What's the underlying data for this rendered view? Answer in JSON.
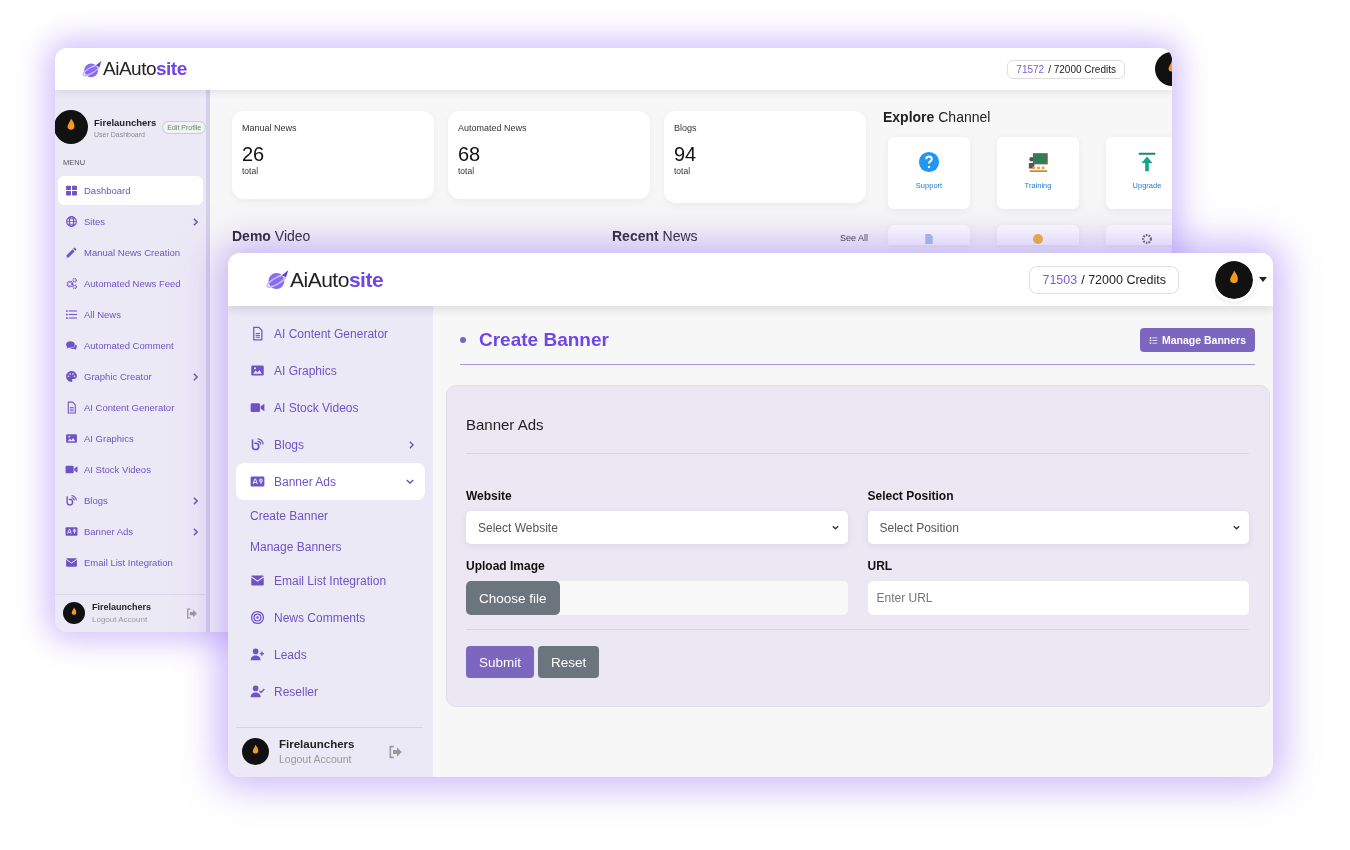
{
  "back_window": {
    "logo": "AiAuto**site**",
    "credits": {
      "used": "71572",
      "total": "/ 72000 Credits"
    },
    "profile": {
      "name": "Firelaunchers",
      "role": "User Dashboard",
      "edit_button": "Edit Profile"
    },
    "menu_heading": "MENU",
    "sidebar": {
      "items": [
        {
          "label": "Dashboard",
          "kind": "grid",
          "selected": true,
          "expandable": false,
          "expanded": false
        },
        {
          "label": "Sites",
          "kind": "globe",
          "selected": false,
          "expandable": true,
          "expanded": false
        },
        {
          "label": "Manual News Creation",
          "kind": "pencil",
          "selected": false,
          "expandable": false,
          "expanded": false
        },
        {
          "label": "Automated News Feed",
          "kind": "gears",
          "selected": false,
          "expandable": false,
          "expanded": false
        },
        {
          "label": "All News",
          "kind": "list",
          "selected": false,
          "expandable": false,
          "expanded": false
        },
        {
          "label": "Automated Comment",
          "kind": "chat",
          "selected": false,
          "expandable": false,
          "expanded": false
        },
        {
          "label": "Graphic Creator",
          "kind": "palette",
          "selected": false,
          "expandable": true,
          "expanded": false
        },
        {
          "label": "AI Content Generator",
          "kind": "document",
          "selected": false,
          "expandable": false,
          "expanded": false
        },
        {
          "label": "AI Graphics",
          "kind": "image",
          "selected": false,
          "expandable": false,
          "expanded": false
        },
        {
          "label": "AI Stock Videos",
          "kind": "video",
          "selected": false,
          "expandable": false,
          "expanded": false
        },
        {
          "label": "Blogs",
          "kind": "blog",
          "selected": false,
          "expandable": true,
          "expanded": false
        },
        {
          "label": "Banner Ads",
          "kind": "ad",
          "selected": false,
          "expandable": true,
          "expanded": false
        },
        {
          "label": "Email List Integration",
          "kind": "mail",
          "selected": false,
          "expandable": false,
          "expanded": false
        }
      ]
    },
    "footer": {
      "name": "Firelaunchers",
      "action": "Logout Account"
    },
    "stats": [
      {
        "label": "Manual News",
        "value": "26",
        "unit": "total"
      },
      {
        "label": "Automated News",
        "value": "68",
        "unit": "total"
      },
      {
        "label": "Blogs",
        "value": "94",
        "unit": "total"
      }
    ],
    "demo_heading": "**Demo** Video",
    "recent_heading": "**Recent** News",
    "see_all": "See All",
    "explore": {
      "heading": "**Explore** Channel",
      "tiles": [
        {
          "kind": "support",
          "label": "Support"
        },
        {
          "kind": "training",
          "label": "Training"
        },
        {
          "kind": "upgrade",
          "label": "Upgrade"
        },
        {
          "kind": "document"
        },
        {
          "kind": "bulb"
        },
        {
          "kind": "gear"
        }
      ]
    }
  },
  "front_window": {
    "logo": "AiAuto**site**",
    "credits": {
      "used": "71503",
      "total": "/ 72000 Credits"
    },
    "sidebar": {
      "items": [
        {
          "label": "AI Content Generator",
          "kind": "document",
          "selected": false,
          "expandable": false,
          "expanded": false
        },
        {
          "label": "AI Graphics",
          "kind": "image",
          "selected": false,
          "expandable": false,
          "expanded": false
        },
        {
          "label": "AI Stock Videos",
          "kind": "video",
          "selected": false,
          "expandable": false,
          "expanded": false
        },
        {
          "label": "Blogs",
          "kind": "blog",
          "selected": false,
          "expandable": true,
          "expanded": false
        },
        {
          "label": "Banner Ads",
          "kind": "ad",
          "selected": true,
          "expandable": true,
          "expanded": true,
          "children": [
            {
              "label": "Create Banner"
            },
            {
              "label": "Manage Banners"
            }
          ]
        },
        {
          "label": "Email List Integration",
          "kind": "mail",
          "selected": false,
          "expandable": false,
          "expanded": false
        },
        {
          "label": "News Comments",
          "kind": "target",
          "selected": false,
          "expandable": false,
          "expanded": false
        },
        {
          "label": "Leads",
          "kind": "user-plus",
          "selected": false,
          "expandable": false,
          "expanded": false
        },
        {
          "label": "Reseller",
          "kind": "user-check",
          "selected": false,
          "expandable": false,
          "expanded": false
        }
      ]
    },
    "footer": {
      "name": "Firelaunchers",
      "action": "Logout Account"
    },
    "page_title": "Create Banner",
    "manage_button": "Manage Banners",
    "form": {
      "title": "Banner Ads",
      "fields": [
        {
          "label": "Website",
          "kind": "select",
          "placeholder": "Select Website"
        },
        {
          "label": "Select Position",
          "kind": "select",
          "placeholder": "Select Position"
        },
        {
          "label": "Upload Image",
          "kind": "file",
          "button": "Choose file"
        },
        {
          "label": "URL",
          "kind": "text",
          "placeholder": "Enter URL"
        }
      ],
      "actions": [
        {
          "label": "Submit",
          "kind": "primary"
        },
        {
          "label": "Reset",
          "kind": "secondary"
        }
      ]
    }
  }
}
